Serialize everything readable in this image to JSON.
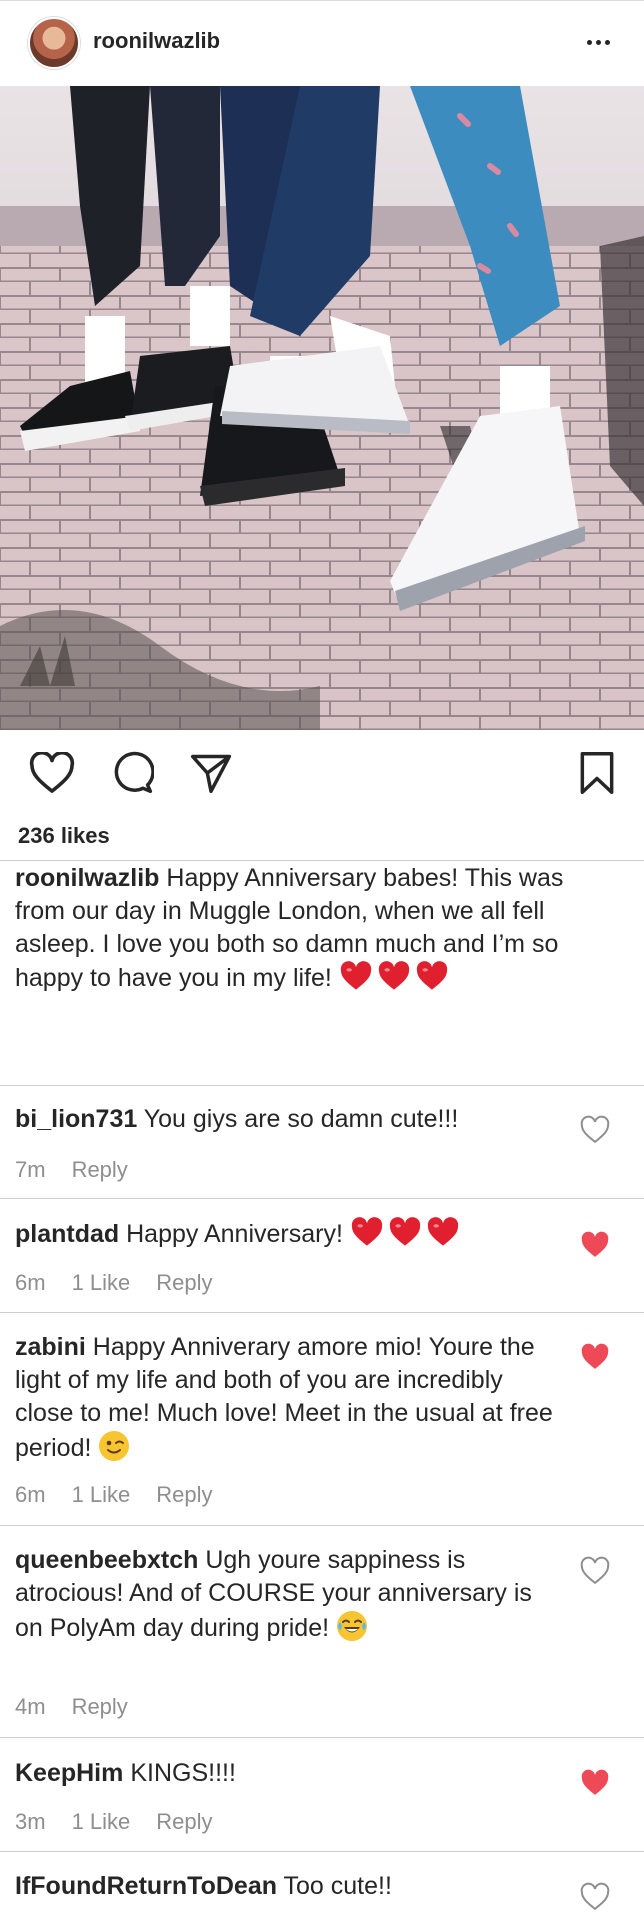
{
  "post": {
    "username": "roonilwazlib",
    "likes": "236 likes",
    "caption_user": "roonilwazlib",
    "caption_text": "Happy Anniversary babes! This was from our day in Muggle London, when we all fell asleep. I love you both so damn much and I’m so happy to have you in my life!"
  },
  "comments": [
    {
      "user": "bi_lion731",
      "text": "You giys are so damn cute!!!",
      "time": "7m",
      "likes": "",
      "reply": "Reply",
      "liked": false
    },
    {
      "user": "plantdad",
      "text": "Happy Anniversary!",
      "time": "6m",
      "likes": "1 Like",
      "reply": "Reply",
      "liked": true
    },
    {
      "user": "zabini",
      "text": "Happy Anniverary amore mio! Youre the light of my life and both of you are incredibly close to me! Much love! Meet in the usual at free period!",
      "time": "6m",
      "likes": "1 Like",
      "reply": "Reply",
      "liked": true
    },
    {
      "user": "queenbeebxtch",
      "text": "Ugh youre sappiness is atrocious! And of COURSE your anniversary is on PolyAm day during pride!",
      "time": "4m",
      "likes": "",
      "reply": "Reply",
      "liked": false
    },
    {
      "user": "KeepHim",
      "text": "KINGS!!!!",
      "time": "3m",
      "likes": "1 Like",
      "reply": "Reply",
      "liked": true
    },
    {
      "user": "IfFoundReturnToDean",
      "text": "Too cute!!",
      "liked": false
    }
  ],
  "icons": {
    "more": "more-icon",
    "like": "heart-icon",
    "comment": "comment-icon",
    "share": "share-icon",
    "save": "bookmark-icon"
  },
  "colors": {
    "liked_heart": "#ed4956",
    "emoji_heart": "#e0202e",
    "muted_text": "#8e8e8e"
  }
}
